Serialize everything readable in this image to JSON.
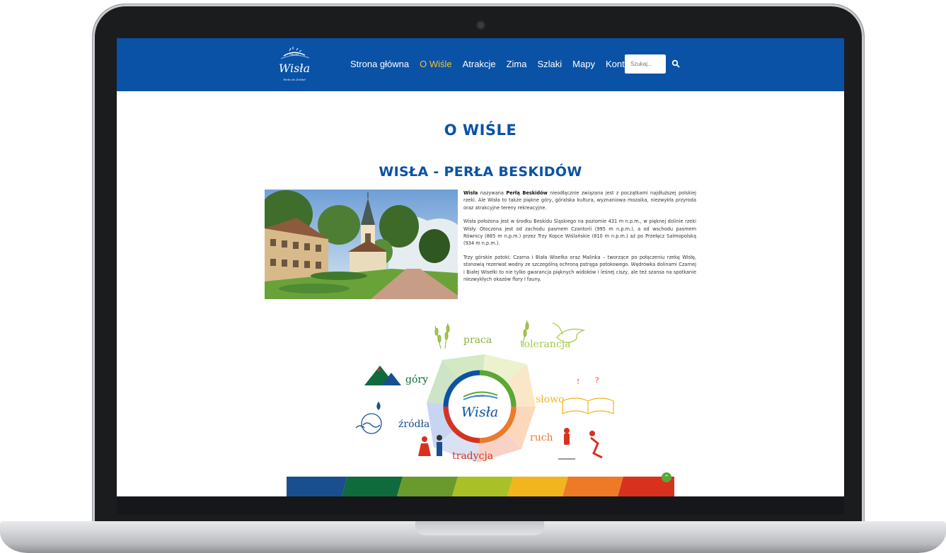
{
  "header": {
    "logo_small": "miasto",
    "logo_name": "Wisła",
    "logo_tagline": "Perła do Źródeł",
    "nav": [
      {
        "label": "Strona główna",
        "active": false
      },
      {
        "label": "O Wiśle",
        "active": true
      },
      {
        "label": "Atrakcje",
        "active": false
      },
      {
        "label": "Zima",
        "active": false
      },
      {
        "label": "Szlaki",
        "active": false
      },
      {
        "label": "Mapy",
        "active": false
      },
      {
        "label": "Kontakt",
        "active": false
      }
    ],
    "search_placeholder": "Szukaj..."
  },
  "main": {
    "page_title": "O WIŚLE",
    "section_title": "WISŁA - PERŁA BESKIDÓW",
    "paragraphs": [
      {
        "lead_bold": "Wisła",
        "mid": " nazywana ",
        "mid_bold": "Perłą Beskidów",
        "rest": " nieodłącznie związana jest z początkami najdłuższej polskiej rzeki. Ale Wisła to także piękne góry, góralska kultura, wyznaniowa mozaika, niezwykła przyroda oraz atrakcyjne tereny rekreacyjne."
      },
      {
        "text": "Wisła położona jest w środku Beskidu Śląskiego na poziomie 431 m n.p.m., w pięknej dolinie rzeki Wisły. Otoczona jest od zachodu pasmem Czantorii (995 m n.p.m.), a od wschodu pasmem Równicy (885 m n.p.m.) przez Trzy Kopce Wiślańskie (810 m n.p.m.) aż po Przełęcz Salmopolską (934 m n.p.m.)."
      },
      {
        "text": "Trzy górskie potoki: Czarna i Biała Wisełka oraz Malinka – tworzące po połączeniu rzekę Wisłę, stanowią rezerwat wodny ze szczególną ochroną pstrąga potokowego. Wędrówka dolinami Czarnej i Białej Wisełki to nie tylko gwarancja pięknych widoków i leśnej ciszy, ale też szansa na spotkanie niezwykłych okazów flory i fauny."
      }
    ],
    "values": {
      "center_small": "miasto",
      "center_name": "Wisła",
      "labels": [
        "praca",
        "tolerancja",
        "słowo",
        "ruch",
        "tradycja",
        "źródła",
        "góry"
      ]
    },
    "colors": {
      "brand_blue": "#0952a6",
      "active_nav": "#f6c232",
      "band": [
        "#1a4f8f",
        "#0f6b3c",
        "#6a9a2e",
        "#a9c127",
        "#f2b51d",
        "#ee7a28",
        "#d8321f"
      ]
    }
  }
}
